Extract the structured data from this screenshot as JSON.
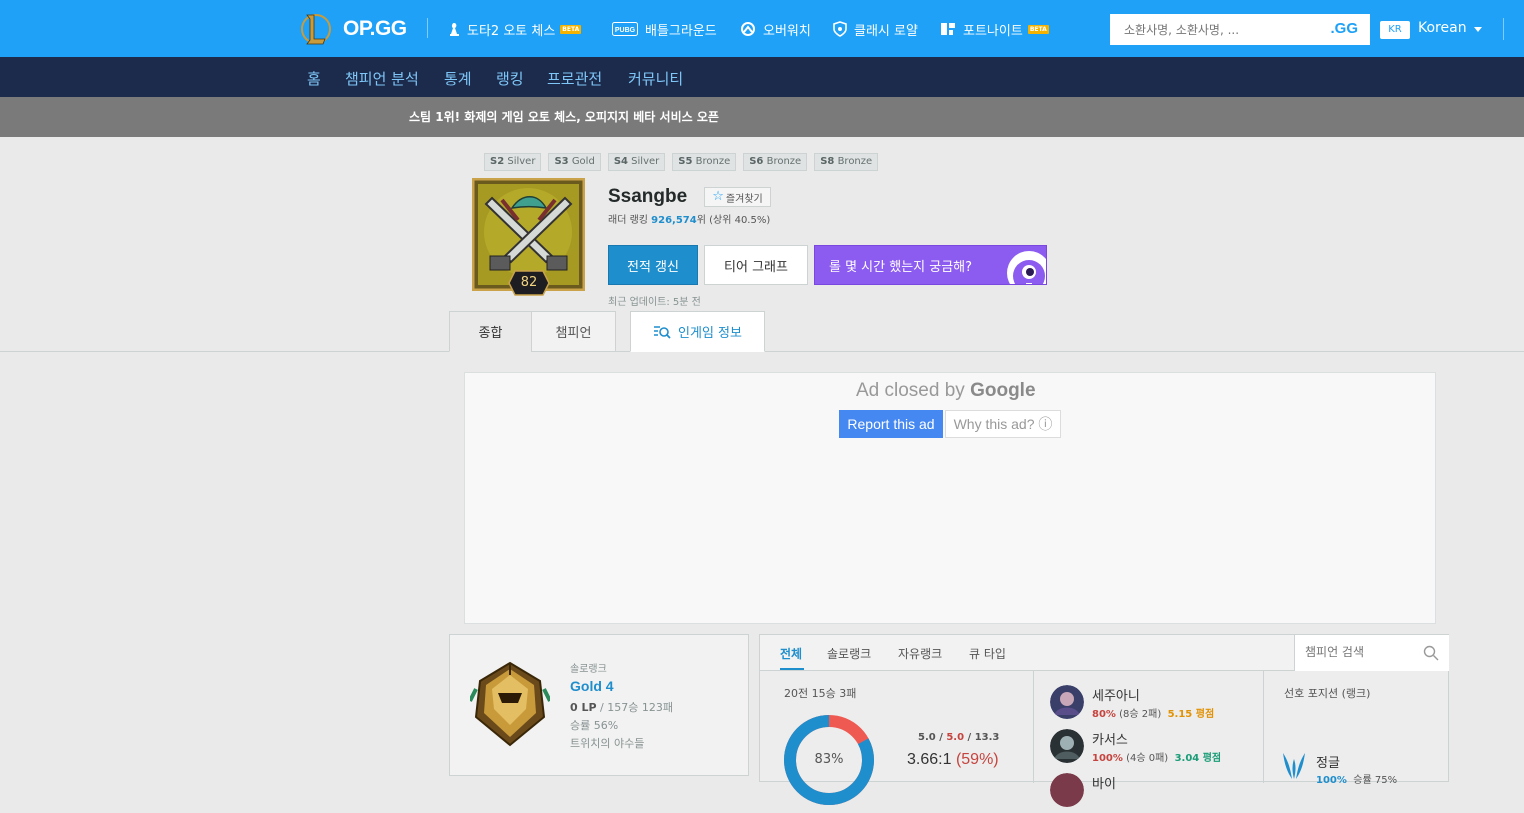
{
  "header": {
    "logo_text": "OP.GG",
    "nav": [
      {
        "label": "도타2 오토 체스",
        "beta": "BETA"
      },
      {
        "label": "배틀그라운드",
        "beta": ""
      },
      {
        "label": "오버워치",
        "beta": ""
      },
      {
        "label": "클래시 로얄",
        "beta": ""
      },
      {
        "label": "포트나이트",
        "beta": "BETA"
      }
    ],
    "search_placeholder": "소환사명, 소환사명, ...",
    "search_suffix": ".GG",
    "region": "KR",
    "language": "Korean"
  },
  "subnav": [
    "홈",
    "챔피언 분석",
    "통계",
    "랭킹",
    "프로관전",
    "커뮤니티"
  ],
  "notice": "스팀 1위! 화제의 게임 오토 체스, 오피지지 베타 서비스 오픈",
  "seasons": [
    {
      "season": "S2",
      "tier": "Silver"
    },
    {
      "season": "S3",
      "tier": "Gold"
    },
    {
      "season": "S4",
      "tier": "Silver"
    },
    {
      "season": "S5",
      "tier": "Bronze"
    },
    {
      "season": "S6",
      "tier": "Bronze"
    },
    {
      "season": "S8",
      "tier": "Bronze"
    }
  ],
  "profile": {
    "level": "82",
    "name": "Ssangbe",
    "favorite_label": "즐겨찾기",
    "ladder_prefix": "래더 랭킹 ",
    "ladder_rank": "926,574",
    "ladder_suffix": "위 (상위 40.5%)",
    "refresh_button": "전적 갱신",
    "tier_graph_button": "티어 그래프",
    "promo_button": "롤 몇 시간 했는지 궁금해?",
    "last_updated": "최근 업데이트: 5분 전"
  },
  "tabs": {
    "overall": "종합",
    "champion": "챔피언",
    "ingame": "인게임 정보"
  },
  "ad": {
    "closed_by": "Ad closed by",
    "brand": "Google",
    "report": "Report this ad",
    "why": "Why this ad? ⓘ"
  },
  "rank": {
    "queue": "솔로랭크",
    "tier": "Gold 4",
    "lp": "0 LP",
    "record": " / 157승 123패",
    "winrate": "승률 56%",
    "league": "트위치의 야수들"
  },
  "stats": {
    "tabs": [
      "전체",
      "솔로랭크",
      "자유랭크",
      "큐 타입"
    ],
    "champ_search_placeholder": "챔피언 검색",
    "games_summary": "20전 15승 3패",
    "win_ratio": 0.83,
    "win_ratio_label": "83%",
    "kda": {
      "kills": "5.0",
      "deaths": "5.0",
      "assists": "13.3"
    },
    "kda_ratio": "3.66:1",
    "kda_pct": "(59%)",
    "colors": {
      "win": "#1f8ecd",
      "loss": "#ee5a52"
    },
    "champions": [
      {
        "name": "세주아니",
        "winrate": "80%",
        "record": "(8승 2패)",
        "kda": "5.15 평점",
        "kda_color": "orange"
      },
      {
        "name": "카서스",
        "winrate": "100%",
        "record": "(4승 0패)",
        "kda": "3.04 평점",
        "kda_color": "green"
      },
      {
        "name": "바이",
        "winrate": "",
        "record": "",
        "kda": "",
        "kda_color": ""
      }
    ],
    "position_title": "선호 포지션 (랭크)",
    "position": {
      "name": "정글",
      "role_pct": "100%",
      "winrate": "승률 75%"
    }
  }
}
